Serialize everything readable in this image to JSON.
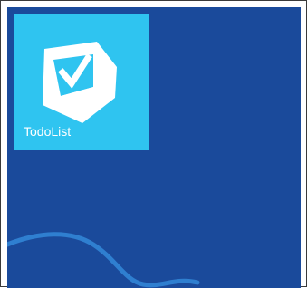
{
  "colors": {
    "start_background": "#1a4a9b",
    "swoosh": "#2f7fd0",
    "tile_background": "#2fc4f0",
    "tile_icon": "#ffffff",
    "tile_label": "#ffffff"
  },
  "tiles": [
    {
      "label": "TodoList",
      "icon": "checkbox-tray-icon"
    }
  ]
}
